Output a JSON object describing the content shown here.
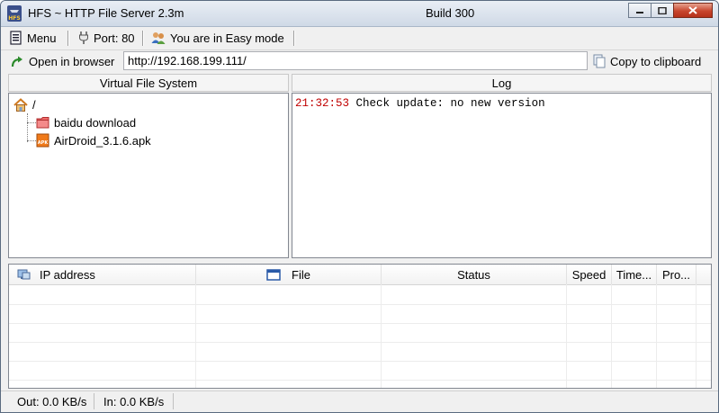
{
  "window": {
    "title": "HFS ~ HTTP File Server 2.3m",
    "build": "Build 300",
    "app_icon_text": "HFS"
  },
  "toolbar": {
    "menu_label": "Menu",
    "port_label": "Port: 80",
    "mode_label": "You are in Easy mode"
  },
  "address_bar": {
    "open_browser_label": "Open in browser",
    "url": "http://192.168.199.111/",
    "copy_label": "Copy to clipboard"
  },
  "vfs": {
    "header": "Virtual File System",
    "root_label": "/",
    "items": [
      {
        "label": "baidu download",
        "icon": "folder-icon"
      },
      {
        "label": "AirDroid_3.1.6.apk",
        "icon": "apk-file-icon",
        "icon_text": "APK"
      }
    ]
  },
  "log": {
    "header": "Log",
    "entries": [
      {
        "time": "21:32:53",
        "message": "Check update: no new version"
      }
    ]
  },
  "connections": {
    "columns": [
      "IP address",
      "File",
      "Status",
      "Speed",
      "Time...",
      "Pro..."
    ]
  },
  "status_bar": {
    "out": "Out: 0.0 KB/s",
    "in": "In: 0.0 KB/s"
  },
  "colors": {
    "log_time": "#c00000",
    "title_gradient_top": "#e9eef5",
    "close_button": "#c8452d"
  }
}
